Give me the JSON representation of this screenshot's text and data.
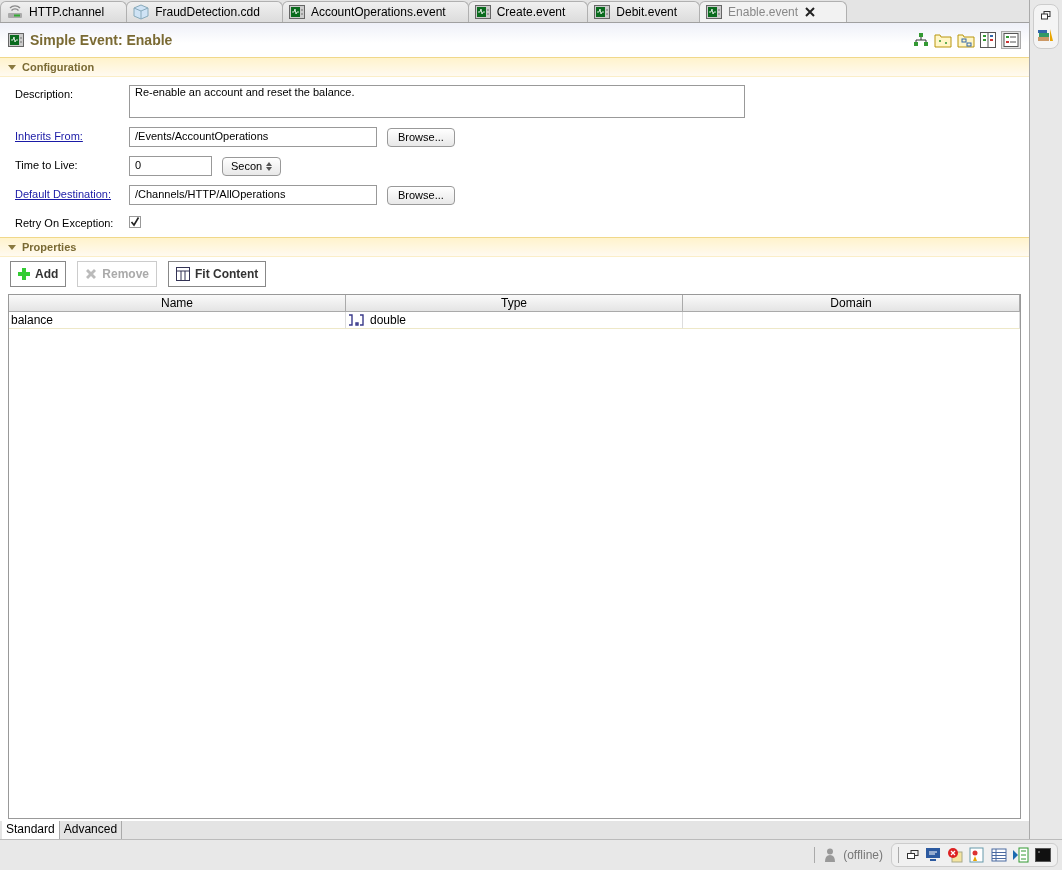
{
  "tabs": [
    {
      "label": "HTTP.channel",
      "kind": "channel",
      "selected": false
    },
    {
      "label": "FraudDetection.cdd",
      "kind": "cdd",
      "selected": false
    },
    {
      "label": "AccountOperations.event",
      "kind": "event",
      "selected": false
    },
    {
      "label": "Create.event",
      "kind": "event",
      "selected": false
    },
    {
      "label": "Debit.event",
      "kind": "event",
      "selected": false
    },
    {
      "label": "Enable.event",
      "kind": "event",
      "selected": true
    }
  ],
  "editor": {
    "title": "Simple Event: Enable"
  },
  "configuration": {
    "title": "Configuration",
    "expanded": true,
    "fields": [
      {
        "kind": "textarea",
        "label": "Description:",
        "link": false,
        "value": "Re-enable an account and reset the balance."
      },
      {
        "kind": "browse",
        "label": "Inherits From:",
        "link": true,
        "value": "/Events/AccountOperations",
        "button": "Browse..."
      },
      {
        "kind": "unit",
        "label": "Time to Live:",
        "link": false,
        "value": "0",
        "unit": "Secon"
      },
      {
        "kind": "browse",
        "label": "Default Destination:",
        "link": true,
        "value": "/Channels/HTTP/AllOperations",
        "button": "Browse..."
      },
      {
        "kind": "checkbox",
        "label": "Retry On Exception:",
        "link": false,
        "checked": true
      }
    ]
  },
  "properties": {
    "title": "Properties",
    "expanded": true,
    "buttons": [
      {
        "label": "Add",
        "kind": "add",
        "disabled": false
      },
      {
        "label": "Remove",
        "kind": "remove",
        "disabled": true
      },
      {
        "label": "Fit Content",
        "kind": "fit",
        "disabled": false
      }
    ],
    "table": {
      "columns": [
        "Name",
        "Type",
        "Domain"
      ],
      "rows": [
        {
          "name": "balance",
          "type": "double"
        }
      ]
    }
  },
  "bottom_tabs": [
    {
      "label": "Standard",
      "selected": true
    },
    {
      "label": "Advanced",
      "selected": false
    }
  ],
  "status_bar": {
    "status": "(offline)"
  }
}
